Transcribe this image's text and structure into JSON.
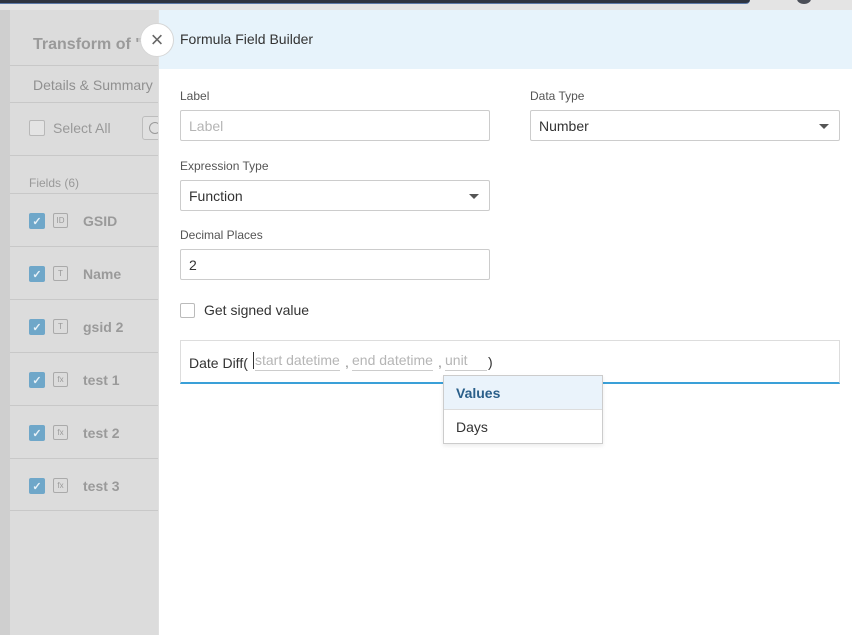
{
  "background": {
    "title": "Transform of \"C",
    "tab": "Details & Summary",
    "select_all": "Select All",
    "fields_header": "Fields (6)",
    "fields": [
      {
        "name": "GSID",
        "type_icon": "ID"
      },
      {
        "name": "Name",
        "type_icon": "T"
      },
      {
        "name": "gsid 2",
        "type_icon": "T"
      },
      {
        "name": "test 1",
        "type_icon": "fx"
      },
      {
        "name": "test 2",
        "type_icon": "fx"
      },
      {
        "name": "test 3",
        "type_icon": "fx"
      }
    ]
  },
  "modal": {
    "title": "Formula Field Builder",
    "close_icon": "×",
    "label": {
      "label": "Label",
      "placeholder": "Label",
      "value": ""
    },
    "data_type": {
      "label": "Data Type",
      "value": "Number"
    },
    "expression_type": {
      "label": "Expression Type",
      "value": "Function"
    },
    "decimal_places": {
      "label": "Decimal Places",
      "value": "2"
    },
    "signed_value": {
      "label": "Get signed value",
      "checked": false
    },
    "expression": {
      "function": "Date Diff(",
      "arg1": "start datetime",
      "arg2": "end datetime",
      "arg3": "unit",
      "separator": ",",
      "close": ")"
    },
    "dropdown": {
      "header": "Values",
      "options": [
        "Days"
      ]
    }
  },
  "colors": {
    "header_bg": "#e7f3fb",
    "accent": "#3aa0d8",
    "checkbox_checked": "#6fa7c9"
  }
}
